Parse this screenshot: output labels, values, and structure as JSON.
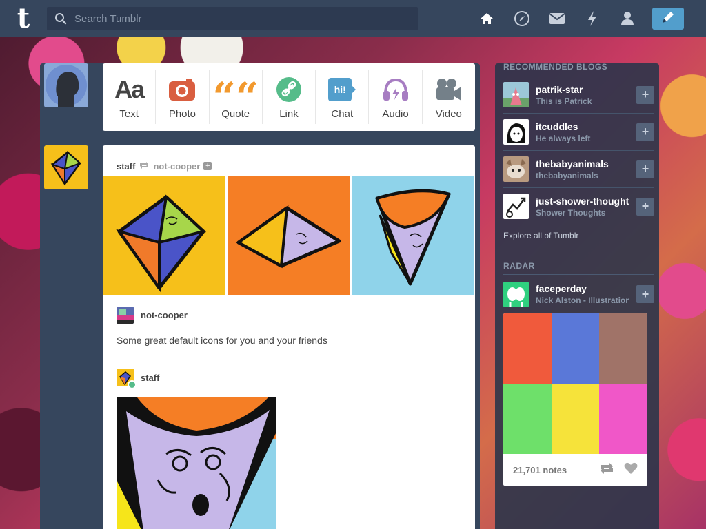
{
  "header": {
    "logo": "t",
    "search_placeholder": "Search Tumblr",
    "nav": [
      "home-icon",
      "explore-icon",
      "inbox-icon",
      "activity-icon",
      "account-icon"
    ],
    "compose_icon": "pencil-icon"
  },
  "post_types": [
    {
      "label": "Text",
      "glyph": "Aa",
      "color": "#444444"
    },
    {
      "label": "Photo",
      "color": "#d95e40"
    },
    {
      "label": "Quote",
      "glyph": "““",
      "color": "#f2992e"
    },
    {
      "label": "Link",
      "color": "#56bc8a"
    },
    {
      "label": "Chat",
      "glyph": "hi!",
      "color": "#529ecc"
    },
    {
      "label": "Audio",
      "color": "#a77dc2"
    },
    {
      "label": "Video",
      "color": "#748089"
    }
  ],
  "post": {
    "author": "staff",
    "reblogged_from": "not-cooper",
    "trail": [
      {
        "name": "not-cooper",
        "text": "Some great default icons for you and your friends"
      },
      {
        "name": "staff"
      }
    ]
  },
  "sidebar": {
    "recommended_heading": "RECOMMENDED BLOGS",
    "blogs": [
      {
        "name": "patrik-star",
        "desc": "This is Patrick"
      },
      {
        "name": "itcuddles",
        "desc": "He always left"
      },
      {
        "name": "thebabyanimals",
        "desc": "thebabyanimals"
      },
      {
        "name": "just-shower-thoughts",
        "desc": "Shower Thoughts"
      }
    ],
    "explore": "Explore all of Tumblr",
    "radar_heading": "RADAR",
    "radar": {
      "name": "faceperday",
      "desc": "Nick Alston - Illustration",
      "notes": "21,701 notes"
    },
    "follow_symbol": "+"
  },
  "colors": {
    "header": "#36465d",
    "accent": "#529ecc"
  }
}
